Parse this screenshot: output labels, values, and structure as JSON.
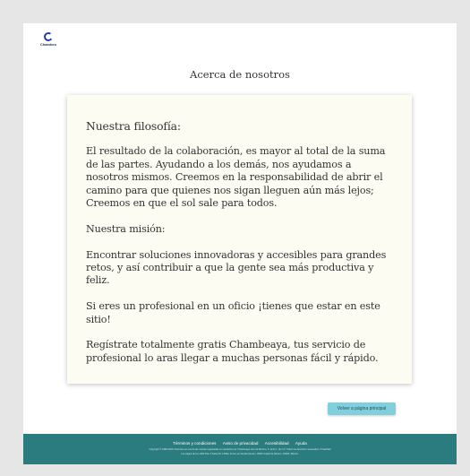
{
  "brand": {
    "logo_text": "Chambeo",
    "color": "#1e3aa8"
  },
  "page": {
    "title": "Acerca de nosotros"
  },
  "content": {
    "philosophy_heading": "Nuestra filosofía:",
    "philosophy_text": "El resultado de la colaboración, es mayor al total de la suma de las partes. Ayudando a los demás, nos ayudamos a nosotros mismos. Creemos en la responsabilidad de abrir el camino para que quienes nos sigan lleguen aún más lejos; Creemos en que el sol sale para todos.",
    "mission_heading": "Nuestra misión:",
    "mission_text": "Encontrar soluciones innovadoras y accesibles para grandes retos, y así contribuir a que la gente sea más productiva y feliz.",
    "professional_text": "Si eres un profesional en un oficio  ¡tienes que estar en este sitio!",
    "register_text": "Regístrate totalmente gratis Chambeaya, tus servicio de profesional lo aras llegar a muchas personas fácil y rápido."
  },
  "actions": {
    "back_label": "Volver a página principal"
  },
  "footer": {
    "links": [
      "Términos y condiciones",
      "Aviso de privacidad",
      "Accesibilidad",
      "Ayuda"
    ],
    "legal_line_1": "Copyright © 1999-2023 Chambeo es una de las marcas registradas en operación por Chambeaya.com de México, S. de R.L. de C.V. Todos los derechos reservados. Privacidad",
    "legal_line_2": "Los pagos de los 1000 Piso 5 Suite PH 2 Milla. Zona Las Vereda Severo. 0000 Ciudad de México, CDMX, México.",
    "bg_color": "#2b7c7e"
  }
}
